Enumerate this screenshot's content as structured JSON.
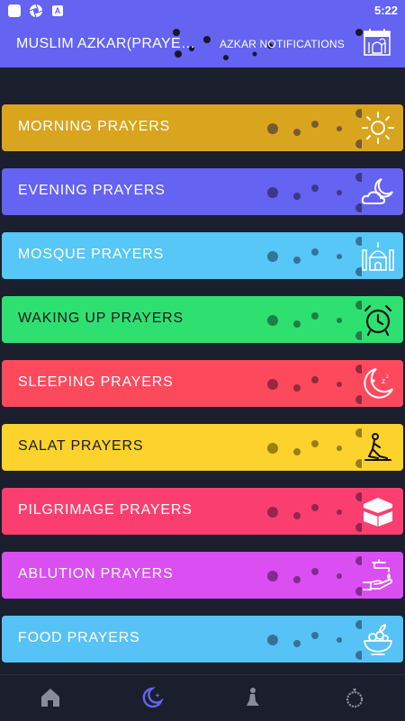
{
  "status_bar": {
    "time": "5:22",
    "icons": [
      "notification-square-icon",
      "aperture-icon",
      "letter-a-icon"
    ]
  },
  "app_bar": {
    "title": "MUSLIM AZKAR(PRAYERS)",
    "notifications_label": "AZKAR NOTIFICATIONS",
    "notifications_icon": "calendar-mosque-icon"
  },
  "categories": [
    {
      "label": "MORNING PRAYERS",
      "color": "#d9a51f",
      "icon": "sun-icon"
    },
    {
      "label": "EVENING PRAYERS",
      "color": "#6563f1",
      "icon": "moon-cloud-icon"
    },
    {
      "label": "MOSQUE PRAYERS",
      "color": "#56c7f7",
      "icon": "mosque-icon"
    },
    {
      "label": "WAKING UP PRAYERS",
      "color": "#2ee070",
      "icon": "alarm-clock-icon"
    },
    {
      "label": "SLEEPING PRAYERS",
      "color": "#fc4a5c",
      "icon": "sleeping-moon-icon"
    },
    {
      "label": "SALAT PRAYERS",
      "color": "#fcd22c",
      "icon": "praying-person-icon"
    },
    {
      "label": "PILGRIMAGE PRAYERS",
      "color": "#fa3f70",
      "icon": "kaaba-icon"
    },
    {
      "label": "ABLUTION PRAYERS",
      "color": "#db4ef2",
      "icon": "ablution-tap-icon"
    },
    {
      "label": "FOOD PRAYERS",
      "color": "#57c2f6",
      "icon": "food-bowl-icon"
    }
  ],
  "bottom_nav": [
    {
      "icon": "home-icon",
      "active": false
    },
    {
      "icon": "crescent-star-icon",
      "active": true
    },
    {
      "icon": "praying-person-icon",
      "active": false
    },
    {
      "icon": "prayer-beads-icon",
      "active": false
    }
  ],
  "colors": {
    "accent": "#6563f1",
    "background": "#1b1e2c",
    "nav_inactive": "#8a8d99"
  }
}
